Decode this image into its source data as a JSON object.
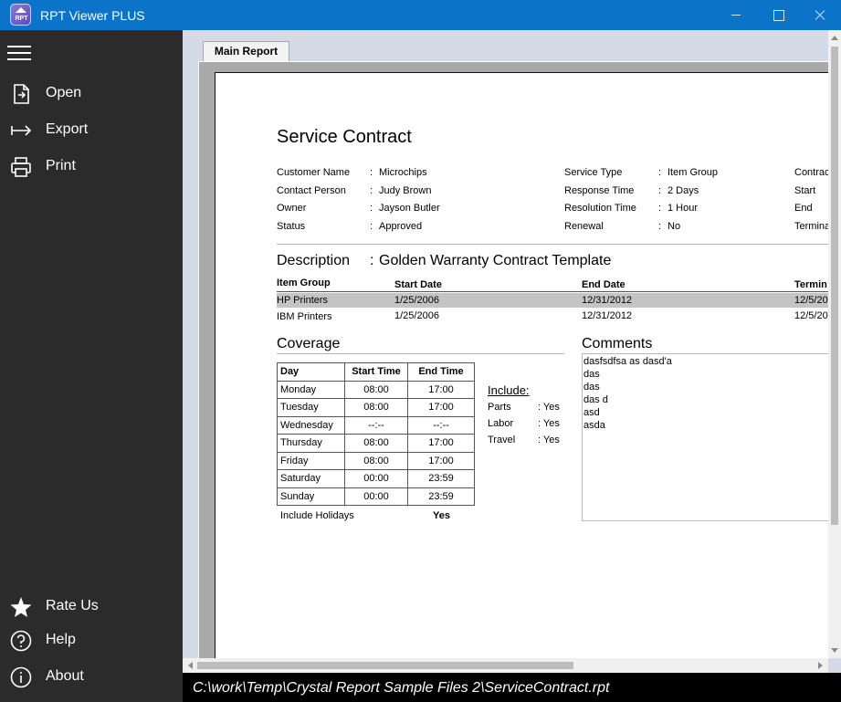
{
  "window": {
    "title": "RPT Viewer PLUS",
    "icon_text": "RPT",
    "icon": "app-logo-icon"
  },
  "sidebar": {
    "items": [
      {
        "label": "Open",
        "icon": "open-file-icon"
      },
      {
        "label": "Export",
        "icon": "export-arrow-icon"
      },
      {
        "label": "Print",
        "icon": "printer-icon"
      },
      {
        "label": "Rate Us",
        "icon": "star-icon"
      },
      {
        "label": "Help",
        "icon": "help-icon"
      },
      {
        "label": "About",
        "icon": "info-icon"
      }
    ]
  },
  "tabs": [
    {
      "label": "Main Report"
    }
  ],
  "status": {
    "path": "C:\\work\\Temp\\Crystal Report Sample Files 2\\ServiceContract.rpt"
  },
  "report": {
    "title": "Service Contract",
    "fields_left": [
      {
        "label": "Customer Name",
        "value": "Microchips"
      },
      {
        "label": "Contact Person",
        "value": "Judy Brown"
      },
      {
        "label": "Owner",
        "value": "Jayson Butler"
      },
      {
        "label": "Status",
        "value": "Approved"
      }
    ],
    "fields_mid": [
      {
        "label": "Service Type",
        "value": "Item Group"
      },
      {
        "label": "Response Time",
        "value": "2 Days"
      },
      {
        "label": "Resolution Time",
        "value": "1 Hour"
      },
      {
        "label": "Renewal",
        "value": "No"
      }
    ],
    "fields_right": [
      "Contrac",
      "Start",
      "End",
      "Termina"
    ],
    "colon": ":",
    "description": {
      "label": "Description",
      "value": "Golden Warranty Contract Template"
    },
    "items": {
      "headers": [
        "Item Group",
        "Start Date",
        "End Date",
        "Termin"
      ],
      "rows": [
        [
          "HP Printers",
          "1/25/2006",
          "12/31/2012",
          "12/5/20"
        ],
        [
          "IBM Printers",
          "1/25/2006",
          "12/31/2012",
          "12/5/20"
        ]
      ]
    },
    "coverage": {
      "title": "Coverage",
      "headers": [
        "Day",
        "Start Time",
        "End Time"
      ],
      "rows": [
        [
          "Monday",
          "08:00",
          "17:00"
        ],
        [
          "Tuesday",
          "08:00",
          "17:00"
        ],
        [
          "Wednesday",
          "--:--",
          "--:--"
        ],
        [
          "Thursday",
          "08:00",
          "17:00"
        ],
        [
          "Friday",
          "08:00",
          "17:00"
        ],
        [
          "Saturday",
          "00:00",
          "23:59"
        ],
        [
          "Sunday",
          "00:00",
          "23:59"
        ]
      ],
      "holidays_label": "Include Holidays",
      "holidays_value": "Yes"
    },
    "include": {
      "title": "Include:",
      "items": [
        {
          "label": "Parts",
          "value": ": Yes"
        },
        {
          "label": "Labor",
          "value": ": Yes"
        },
        {
          "label": "Travel",
          "value": ": Yes"
        }
      ]
    },
    "comments": {
      "title": "Comments",
      "lines": [
        "dasfsdfsa as dasd'a",
        "das",
        "das",
        "das d",
        "asd",
        "asda"
      ]
    }
  }
}
